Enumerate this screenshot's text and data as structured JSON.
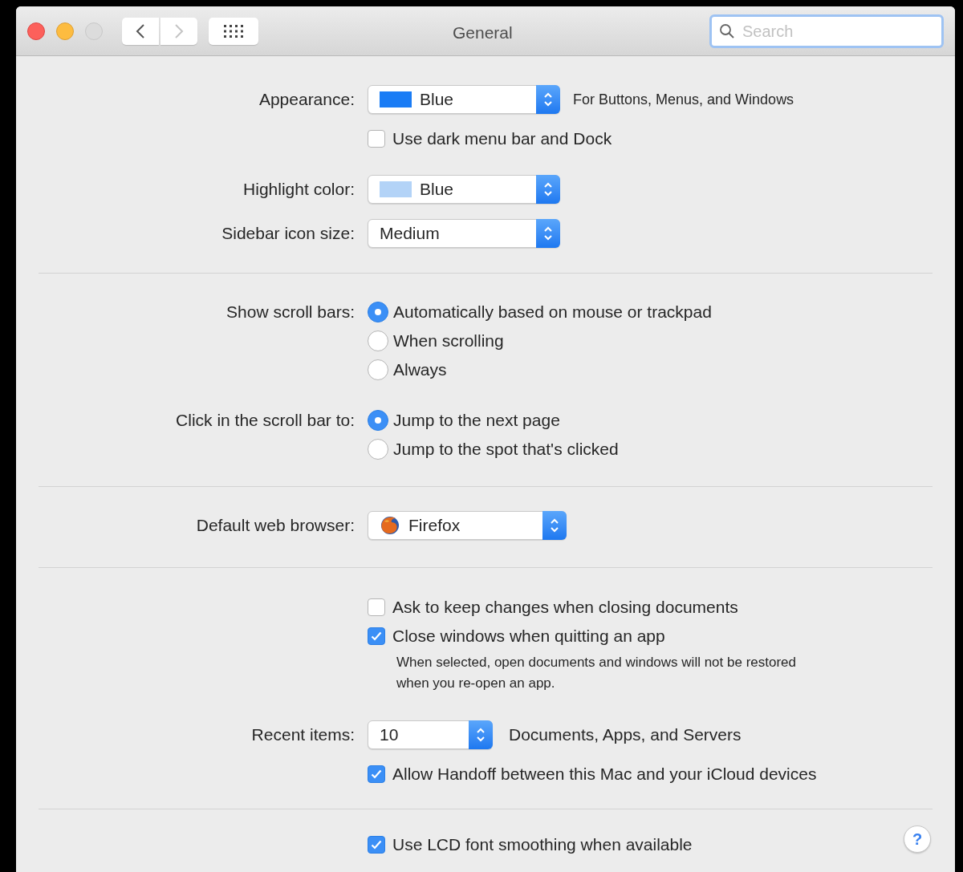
{
  "window": {
    "title": "General",
    "search": {
      "placeholder": "Search"
    }
  },
  "sections": [
    {
      "rows": [
        {
          "kind": "popup",
          "label": "Appearance:",
          "value": "Blue",
          "color": "#1a7cf5",
          "suffix": "For Buttons, Menus, and Windows"
        },
        {
          "kind": "checkbox",
          "text": "Use dark menu bar and Dock",
          "checked": false
        },
        {
          "kind": "popup",
          "label": "Highlight color:",
          "value": "Blue",
          "color": "#b3d3f7"
        },
        {
          "kind": "popup",
          "label": "Sidebar icon size:",
          "value": "Medium"
        }
      ]
    },
    {
      "rows": [
        {
          "kind": "radio",
          "label": "Show scroll bars:",
          "options": [
            {
              "text": "Automatically based on mouse or trackpad",
              "selected": true
            },
            {
              "text": "When scrolling",
              "selected": false
            },
            {
              "text": "Always",
              "selected": false
            }
          ]
        },
        {
          "kind": "radio",
          "label": "Click in the scroll bar to:",
          "options": [
            {
              "text": "Jump to the next page",
              "selected": true
            },
            {
              "text": "Jump to the spot that's clicked",
              "selected": false
            }
          ]
        }
      ]
    },
    {
      "rows": [
        {
          "kind": "popup",
          "label": "Default web browser:",
          "value": "Firefox",
          "app_icon": true
        }
      ]
    },
    {
      "rows": [
        {
          "kind": "checkbox",
          "text": "Ask to keep changes when closing documents",
          "checked": false
        },
        {
          "kind": "checkbox",
          "text": "Close windows when quitting an app",
          "checked": true
        },
        {
          "kind": "note",
          "text": "When selected, open documents and windows will not be restored when you re-open an app."
        },
        {
          "kind": "popup",
          "label": "Recent items:",
          "value": "10",
          "suffix": "Documents, Apps, and Servers"
        },
        {
          "kind": "checkbox",
          "text": "Allow Handoff between this Mac and your iCloud devices",
          "checked": true
        }
      ]
    },
    {
      "rows": [
        {
          "kind": "checkbox",
          "text": "Use LCD font smoothing when available",
          "checked": true
        }
      ],
      "help": "?"
    }
  ]
}
